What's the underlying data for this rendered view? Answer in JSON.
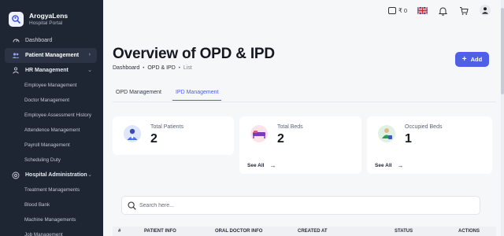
{
  "brand": {
    "name": "ArogyaLens",
    "subtitle": "Hospital Portal"
  },
  "sidebar": {
    "items": [
      {
        "label": "Dashboard",
        "icon": "dashboard-icon"
      },
      {
        "label": "Patient Management",
        "icon": "users-icon",
        "active": true
      },
      {
        "label": "HR Management",
        "icon": "hr-icon",
        "expanded": true
      },
      {
        "label": "Hospital Administration",
        "icon": "hospital-icon",
        "expanded": true
      }
    ],
    "hr_subitems": [
      "Employee Management",
      "Doctor Management",
      "Employee Assessment History",
      "Attendence Management",
      "Payroll Management",
      "Scheduling Duty"
    ],
    "admin_subitems": [
      "Treatment Managements",
      "Blood Bank",
      "Machine Managements",
      "Job Management"
    ]
  },
  "topbar": {
    "wallet_amount": "₹ 0"
  },
  "page": {
    "title": "Overview of OPD & IPD",
    "breadcrumb": [
      "Dashboard",
      "OPD & IPD",
      "List"
    ],
    "add_label": "Add"
  },
  "tabs": [
    {
      "label": "OPD Management",
      "active": false
    },
    {
      "label": "IPD Management",
      "active": true
    }
  ],
  "cards": [
    {
      "label": "Total Patients",
      "value": "2"
    },
    {
      "label": "Total Beds",
      "value": "2",
      "link": "See All"
    },
    {
      "label": "Occupied Beds",
      "value": "1",
      "link": "See All"
    }
  ],
  "search": {
    "placeholder": "Search here..."
  },
  "table": {
    "columns": [
      "#",
      "PATIENT INFO",
      "ORAL DOCTOR INFO",
      "CREATED AT",
      "STATUS",
      "ACTIONS"
    ]
  },
  "colors": {
    "accent": "#4f5fe6",
    "sidebar_bg": "#1e2533"
  }
}
